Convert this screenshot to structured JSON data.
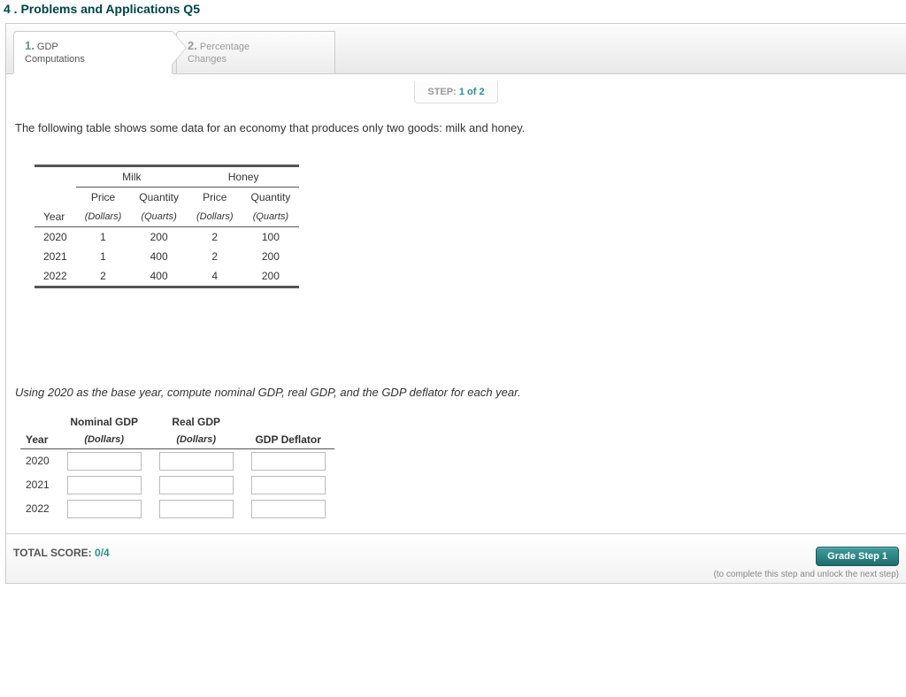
{
  "title": "4 . Problems and Applications Q5",
  "tabs": [
    {
      "num": "1.",
      "line1": "GDP",
      "line2": "Computations"
    },
    {
      "num": "2.",
      "line1": "Percentage",
      "line2": "Changes"
    }
  ],
  "step": {
    "prefix": "STEP:",
    "current": "1",
    "sep": "of",
    "total": "2"
  },
  "intro": "The following table shows some data for an economy that produces only two goods: milk and honey.",
  "table1": {
    "goods": [
      "Milk",
      "Honey"
    ],
    "subhdr": [
      "Price",
      "Quantity",
      "Price",
      "Quantity"
    ],
    "units": [
      "(Dollars)",
      "(Quarts)",
      "(Dollars)",
      "(Quarts)"
    ],
    "yearLabel": "Year",
    "rows": [
      {
        "year": "2020",
        "v": [
          "1",
          "200",
          "2",
          "100"
        ]
      },
      {
        "year": "2021",
        "v": [
          "1",
          "400",
          "2",
          "200"
        ]
      },
      {
        "year": "2022",
        "v": [
          "2",
          "400",
          "4",
          "200"
        ]
      }
    ]
  },
  "instruct": "Using 2020 as the base year, compute nominal GDP, real GDP, and the GDP deflator for each year.",
  "table2": {
    "hdr": [
      "Nominal GDP",
      "Real GDP",
      ""
    ],
    "units": [
      "(Dollars)",
      "(Dollars)",
      "GDP Deflator"
    ],
    "yearLabel": "Year",
    "years": [
      "2020",
      "2021",
      "2022"
    ]
  },
  "footer": {
    "scoreLabel": "TOTAL SCORE:",
    "score": "0/4",
    "button": "Grade Step 1",
    "hint": "(to complete this step and unlock the next step)"
  }
}
